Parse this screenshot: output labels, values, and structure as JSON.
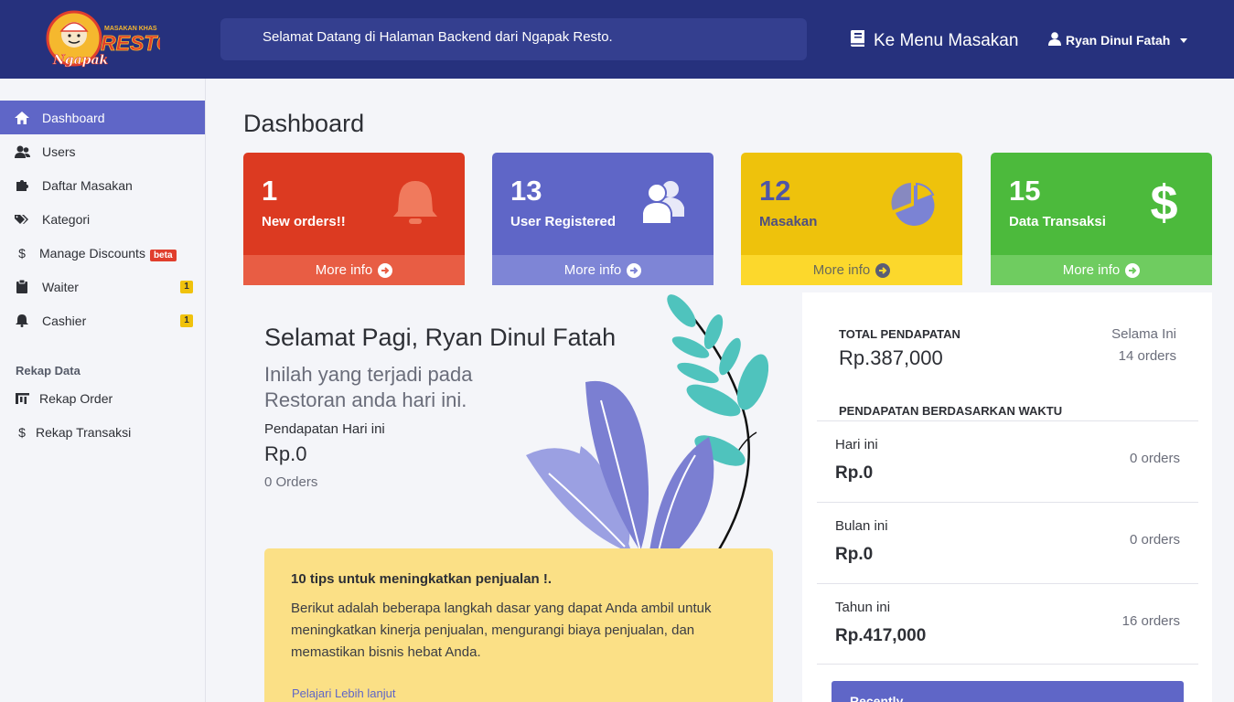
{
  "header": {
    "logo_top_text": "MASAKAN KHAS",
    "logo_main_text": "RESTO",
    "logo_script_text": "Ngapak",
    "welcome_text": "Selamat Datang di Halaman Backend dari Ngapak Resto.",
    "menu_link_label": "Ke Menu Masakan",
    "user_name": "Ryan Dinul Fatah"
  },
  "sidebar": {
    "items": [
      {
        "label": "Dashboard",
        "icon": "home-icon"
      },
      {
        "label": "Users",
        "icon": "users-icon"
      },
      {
        "label": "Daftar Masakan",
        "icon": "puzzle-icon"
      },
      {
        "label": "Kategori",
        "icon": "tags-icon"
      },
      {
        "label": "Manage Discounts",
        "icon": "dollar-icon",
        "badge": "beta"
      },
      {
        "label": "Waiter",
        "icon": "clipboard-icon",
        "badge": "1"
      },
      {
        "label": "Cashier",
        "icon": "bell-icon",
        "badge": "1"
      }
    ],
    "section_title": "Rekap Data",
    "rekap_items": [
      {
        "label": "Rekap Order",
        "icon": "chart-icon"
      },
      {
        "label": "Rekap Transaksi",
        "icon": "dollar-icon"
      }
    ]
  },
  "main": {
    "page_title": "Dashboard",
    "cards": [
      {
        "number": "1",
        "caption": "New orders!!",
        "more": "More info",
        "icon": "bell-icon",
        "color": "#dc3a21"
      },
      {
        "number": "13",
        "caption": "User Registered",
        "more": "More info",
        "icon": "users-icon",
        "color": "#5f66c7"
      },
      {
        "number": "12",
        "caption": "Masakan",
        "more": "More info",
        "icon": "pie-chart-icon",
        "color": "#eec20c"
      },
      {
        "number": "15",
        "caption": "Data Transaksi",
        "more": "More info",
        "icon": "dollar-icon",
        "color": "#4cba3c"
      }
    ],
    "greeting": "Selamat Pagi, Ryan Dinul Fatah",
    "greeting_sub": "Inilah yang terjadi pada Restoran anda hari ini.",
    "today_label": "Pendapatan Hari ini",
    "today_value": "Rp.0",
    "today_orders": "0 Orders",
    "tips": {
      "title": "10 tips untuk meningkatkan penjualan !.",
      "body": "Berikut adalah beberapa langkah dasar yang dapat Anda ambil untuk meningkatkan kinerja penjualan, mengurangi biaya penjualan, dan memastikan bisnis hebat Anda.",
      "link": "Pelajari Lebih lanjut"
    }
  },
  "revenue": {
    "total_label": "TOTAL PENDAPATAN",
    "total_value": "Rp.387,000",
    "period": "Selama Ini",
    "orders": "14 orders",
    "by_time_label": "PENDAPATAN BERDASARKAN WAKTU",
    "rows": [
      {
        "label": "Hari ini",
        "value": "Rp.0",
        "orders": "0 orders"
      },
      {
        "label": "Bulan ini",
        "value": "Rp.0",
        "orders": "0 orders"
      },
      {
        "label": "Tahun ini",
        "value": "Rp.417,000",
        "orders": "16 orders"
      }
    ],
    "recent_label": "Recently"
  }
}
